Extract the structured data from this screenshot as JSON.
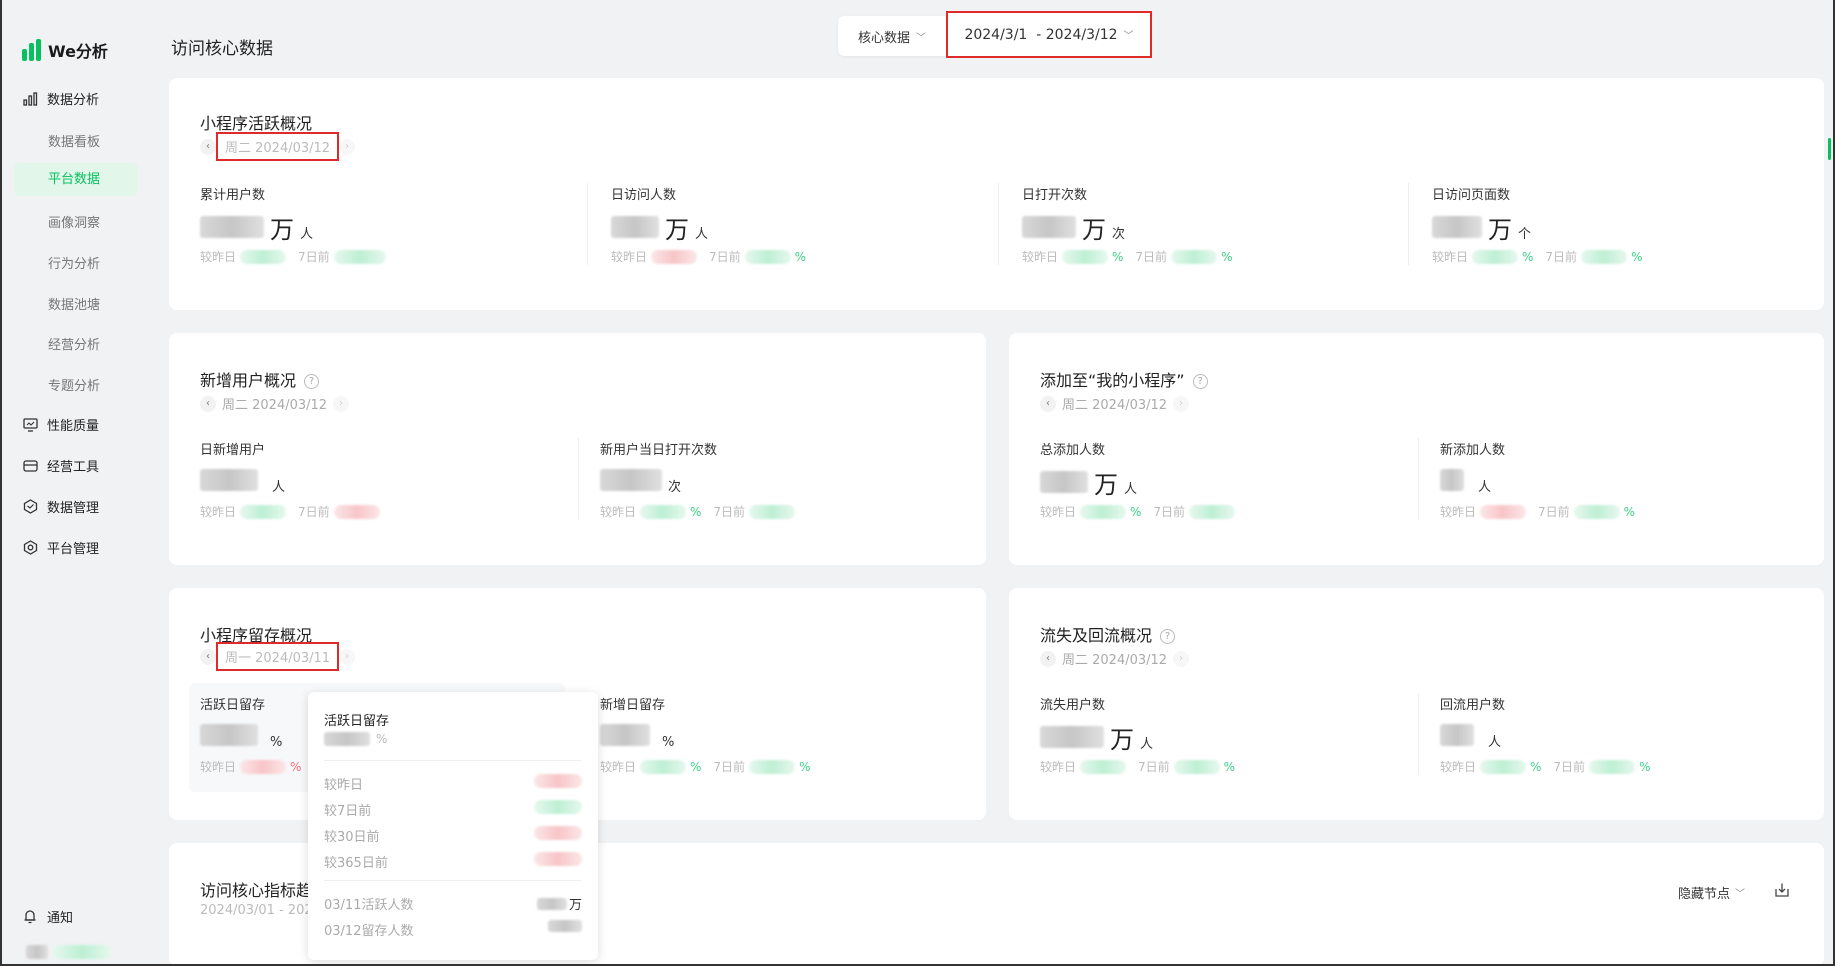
{
  "app": {
    "name": "We分析"
  },
  "sidebar": {
    "groups": [
      {
        "label": "数据分析",
        "icon": "bar-chart-icon"
      },
      {
        "label": "性能质量",
        "icon": "monitor-icon"
      },
      {
        "label": "经营工具",
        "icon": "wallet-icon"
      },
      {
        "label": "数据管理",
        "icon": "cube-icon"
      },
      {
        "label": "平台管理",
        "icon": "gear-icon"
      }
    ],
    "sub_items": [
      {
        "label": "数据看板",
        "active": false
      },
      {
        "label": "平台数据",
        "active": true
      },
      {
        "label": "画像洞察",
        "active": false
      },
      {
        "label": "行为分析",
        "active": false
      },
      {
        "label": "数据池塘",
        "active": false
      },
      {
        "label": "经营分析",
        "active": false
      },
      {
        "label": "专题分析",
        "active": false
      }
    ],
    "notify_label": "通知"
  },
  "header": {
    "title": "访问核心数据",
    "category_select": "核心数据",
    "date_range": "2024/3/1  - 2024/3/12"
  },
  "active_overview": {
    "title": "小程序活跃概况",
    "date": "周二 2024/03/12",
    "metrics": [
      {
        "label": "累计用户数",
        "unit_big": "万",
        "unit_small": "人"
      },
      {
        "label": "日访问人数",
        "unit_big": "万",
        "unit_small": "人"
      },
      {
        "label": "日打开次数",
        "unit_big": "万",
        "unit_small": "次"
      },
      {
        "label": "日访问页面数",
        "unit_big": "万",
        "unit_small": "个"
      }
    ],
    "compare_prev": "较昨日",
    "compare_7d": "7日前"
  },
  "new_users": {
    "title": "新增用户概况",
    "date": "周二 2024/03/12",
    "metrics": [
      {
        "label": "日新增用户",
        "unit_small": "人"
      },
      {
        "label": "新用户当日打开次数",
        "unit_small": "次"
      }
    ]
  },
  "added_to_mine": {
    "title": "添加至“我的小程序”",
    "date": "周二 2024/03/12",
    "metrics": [
      {
        "label": "总添加人数",
        "unit_big": "万",
        "unit_small": "人"
      },
      {
        "label": "新添加人数",
        "unit_small": "人"
      }
    ]
  },
  "retention": {
    "title": "小程序留存概况",
    "date": "周一 2024/03/11",
    "metrics": [
      {
        "label": "活跃日留存",
        "unit_small": "%"
      },
      {
        "label": "新增日留存",
        "unit_small": "%"
      }
    ]
  },
  "churn": {
    "title": "流失及回流概况",
    "date": "周二 2024/03/12",
    "metrics": [
      {
        "label": "流失用户数",
        "unit_big": "万",
        "unit_small": "人"
      },
      {
        "label": "回流用户数",
        "unit_small": "人"
      }
    ]
  },
  "tooltip": {
    "title": "活跃日留存",
    "unit": "%",
    "rows": [
      "较昨日",
      "较7日前",
      "较30日前",
      "较365日前"
    ],
    "active_label": "03/11活跃人数",
    "active_unit": "万",
    "retained_label": "03/12留存人数"
  },
  "trend": {
    "title": "访问核心指标趋",
    "range": "2024/03/01 - 202",
    "hide_nodes": "隐藏节点"
  },
  "compare_labels": {
    "prev": "较昨日",
    "week": "7日前",
    "pct": "%"
  }
}
